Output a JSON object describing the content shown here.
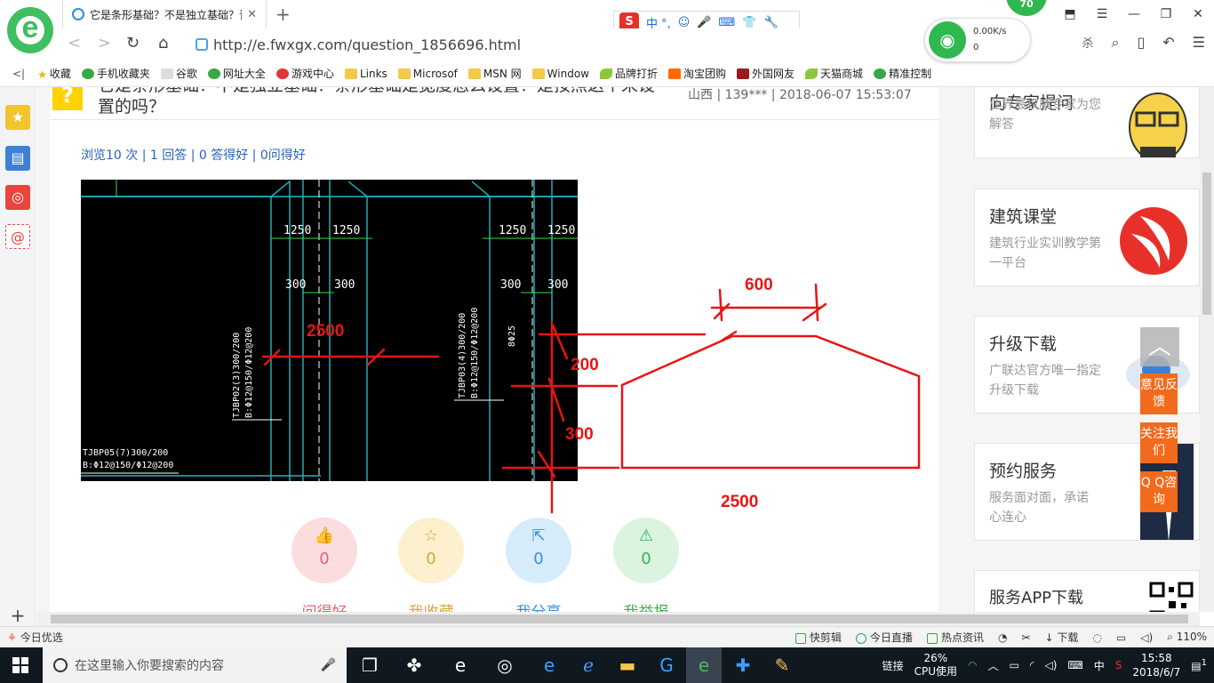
{
  "browser": {
    "tab_title": "它是条形基础？不是独立基础？该",
    "url": "http://e.fwxgx.com/question_1856696.html",
    "ime_label": "中 °,",
    "network": {
      "down": "0.00K/s",
      "up": "0"
    },
    "badge": "70",
    "toolbar_partial": "杀"
  },
  "bookmarks": [
    {
      "label": "收藏",
      "icon": "star"
    },
    {
      "label": "手机收藏夹",
      "icon": "green"
    },
    {
      "label": "谷歌",
      "icon": "doc"
    },
    {
      "label": "网址大全",
      "icon": "green"
    },
    {
      "label": "游戏中心",
      "icon": "red"
    },
    {
      "label": "Links",
      "icon": "folder"
    },
    {
      "label": "Microsof",
      "icon": "folder"
    },
    {
      "label": "MSN 网",
      "icon": "folder"
    },
    {
      "label": "Window",
      "icon": "folder"
    },
    {
      "label": "品牌打折",
      "icon": "leaf"
    },
    {
      "label": "淘宝团购",
      "icon": "taobao"
    },
    {
      "label": "外国网友",
      "icon": "maroon"
    },
    {
      "label": "天猫商城",
      "icon": "leaf"
    },
    {
      "label": "精准控制",
      "icon": "green"
    }
  ],
  "question": {
    "title": "它是条形基础？不是独立基础？条形基础是宽度怎么设置？是按照这个来设置的吗？",
    "meta": "山西 | 139*** | 2018-06-07 15:53:07",
    "stats": "浏览10 次 | 1 回答 | 0 答得好 | 0问得好"
  },
  "cad": {
    "dims": [
      "1250",
      "1250",
      "1250",
      "1250",
      "300",
      "300",
      "300",
      "300"
    ],
    "labels": [
      "TJBP02(3)300/200",
      "B:Φ12@150/Φ12@200",
      "TJBP03(4)300/200",
      "B:Φ12@150/Φ12@200",
      "TJBP05(7)300/200",
      "B:Φ12@150/Φ12@200",
      "8Φ25"
    ]
  },
  "sketch": {
    "labels": [
      "600",
      "2500",
      "200",
      "300",
      "2500"
    ],
    "color": "#e81414"
  },
  "actions": [
    {
      "count": "0",
      "label": "问得好",
      "icon": "thumbs-up-icon",
      "bg": "#fbdde0",
      "fg": "#e9606f"
    },
    {
      "count": "0",
      "label": "我收藏",
      "icon": "star-icon",
      "bg": "#fdf0cf",
      "fg": "#d9a638"
    },
    {
      "count": "0",
      "label": "我分享",
      "icon": "share-icon",
      "bg": "#d6ecfb",
      "fg": "#3a8fd8"
    },
    {
      "count": "0",
      "label": "我举报",
      "icon": "warning-icon",
      "bg": "#dcf3df",
      "fg": "#3fae52"
    }
  ],
  "sidebar": [
    {
      "title": "向专家提问",
      "sub": "业界最权威专家为您解答"
    },
    {
      "title": "建筑课堂",
      "sub": "建筑行业实训教学第一平台"
    },
    {
      "title": "升级下载",
      "sub": "广联达官方唯一指定升级下载"
    },
    {
      "title": "预约服务",
      "sub": "服务面对面，承诺心连心"
    },
    {
      "title": "服务APP下载",
      "sub": ""
    }
  ],
  "float_buttons": [
    "意见反馈",
    "关注我们",
    "Q Q咨询"
  ],
  "statusbar": {
    "left": "今日优选",
    "right": [
      "快剪辑",
      "今日直播",
      "热点资讯",
      "下载",
      "110%"
    ]
  },
  "taskbar": {
    "search_placeholder": "在这里输入你要搜索的内容",
    "link_label": "链接",
    "cpu_percent": "26%",
    "cpu_label": "CPU使用",
    "ime": "中",
    "time": "15:58",
    "date": "2018/6/7",
    "notifications": "1"
  }
}
